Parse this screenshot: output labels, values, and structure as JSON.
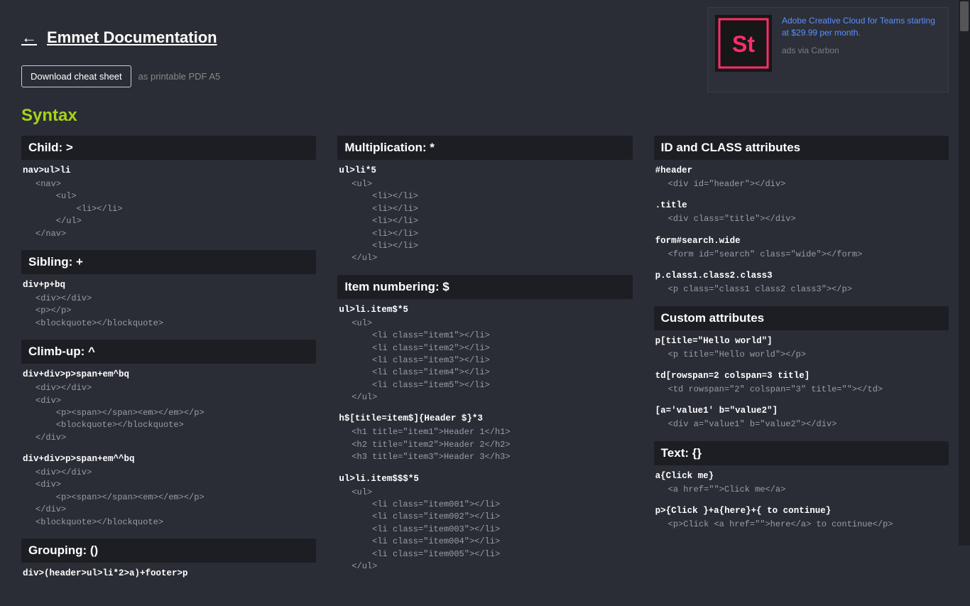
{
  "header": {
    "back_arrow": "←",
    "back_text": "Emmet Documentation",
    "download_label": "Download cheat sheet",
    "download_note": "as printable PDF A5"
  },
  "ad": {
    "link_text": "Adobe Creative Cloud for Teams starting at $29.99 per month.",
    "via_text": "ads via Carbon",
    "icon_letters": "St"
  },
  "section_title": "Syntax",
  "col1": {
    "h_child": "Child: >",
    "child_abbr": "nav>ul>li",
    "child_exp": "<nav>\n    <ul>\n        <li></li>\n    </ul>\n</nav>",
    "h_sibling": "Sibling: +",
    "sibling_abbr": "div+p+bq",
    "sibling_exp": "<div></div>\n<p></p>\n<blockquote></blockquote>",
    "h_climb": "Climb-up: ^",
    "climb1_abbr": "div+div>p>span+em^bq",
    "climb1_exp": "<div></div>\n<div>\n    <p><span></span><em></em></p>\n    <blockquote></blockquote>\n</div>",
    "climb2_abbr": "div+div>p>span+em^^bq",
    "climb2_exp": "<div></div>\n<div>\n    <p><span></span><em></em></p>\n</div>\n<blockquote></blockquote>",
    "h_group": "Grouping: ()",
    "group_abbr": "div>(header>ul>li*2>a)+footer>p"
  },
  "col2": {
    "h_mult": "Multiplication: *",
    "mult_abbr": "ul>li*5",
    "mult_exp": "<ul>\n    <li></li>\n    <li></li>\n    <li></li>\n    <li></li>\n    <li></li>\n</ul>",
    "h_itemnum": "Item numbering: $",
    "in1_abbr": "ul>li.item$*5",
    "in1_exp": "<ul>\n    <li class=\"item1\"></li>\n    <li class=\"item2\"></li>\n    <li class=\"item3\"></li>\n    <li class=\"item4\"></li>\n    <li class=\"item5\"></li>\n</ul>",
    "in2_abbr": "h$[title=item$]{Header $}*3",
    "in2_exp": "<h1 title=\"item1\">Header 1</h1>\n<h2 title=\"item2\">Header 2</h2>\n<h3 title=\"item3\">Header 3</h3>",
    "in3_abbr": "ul>li.item$$$*5",
    "in3_exp": "<ul>\n    <li class=\"item001\"></li>\n    <li class=\"item002\"></li>\n    <li class=\"item003\"></li>\n    <li class=\"item004\"></li>\n    <li class=\"item005\"></li>\n</ul>"
  },
  "col3": {
    "h_idclass": "ID and CLASS attributes",
    "ic1_abbr": "#header",
    "ic1_exp": "<div id=\"header\"></div>",
    "ic2_abbr": ".title",
    "ic2_exp": "<div class=\"title\"></div>",
    "ic3_abbr": "form#search.wide",
    "ic3_exp": "<form id=\"search\" class=\"wide\"></form>",
    "ic4_abbr": "p.class1.class2.class3",
    "ic4_exp": "<p class=\"class1 class2 class3\"></p>",
    "h_custom": "Custom attributes",
    "ca1_abbr": "p[title=\"Hello world\"]",
    "ca1_exp": "<p title=\"Hello world\"></p>",
    "ca2_abbr": "td[rowspan=2 colspan=3 title]",
    "ca2_exp": "<td rowspan=\"2\" colspan=\"3\" title=\"\"></td>",
    "ca3_abbr": "[a='value1' b=\"value2\"]",
    "ca3_exp": "<div a=\"value1\" b=\"value2\"></div>",
    "h_text": "Text: {}",
    "t1_abbr": "a{Click me}",
    "t1_exp": "<a href=\"\">Click me</a>",
    "t2_abbr": "p>{Click }+a{here}+{ to continue}",
    "t2_exp": "<p>Click <a href=\"\">here</a> to continue</p>"
  }
}
